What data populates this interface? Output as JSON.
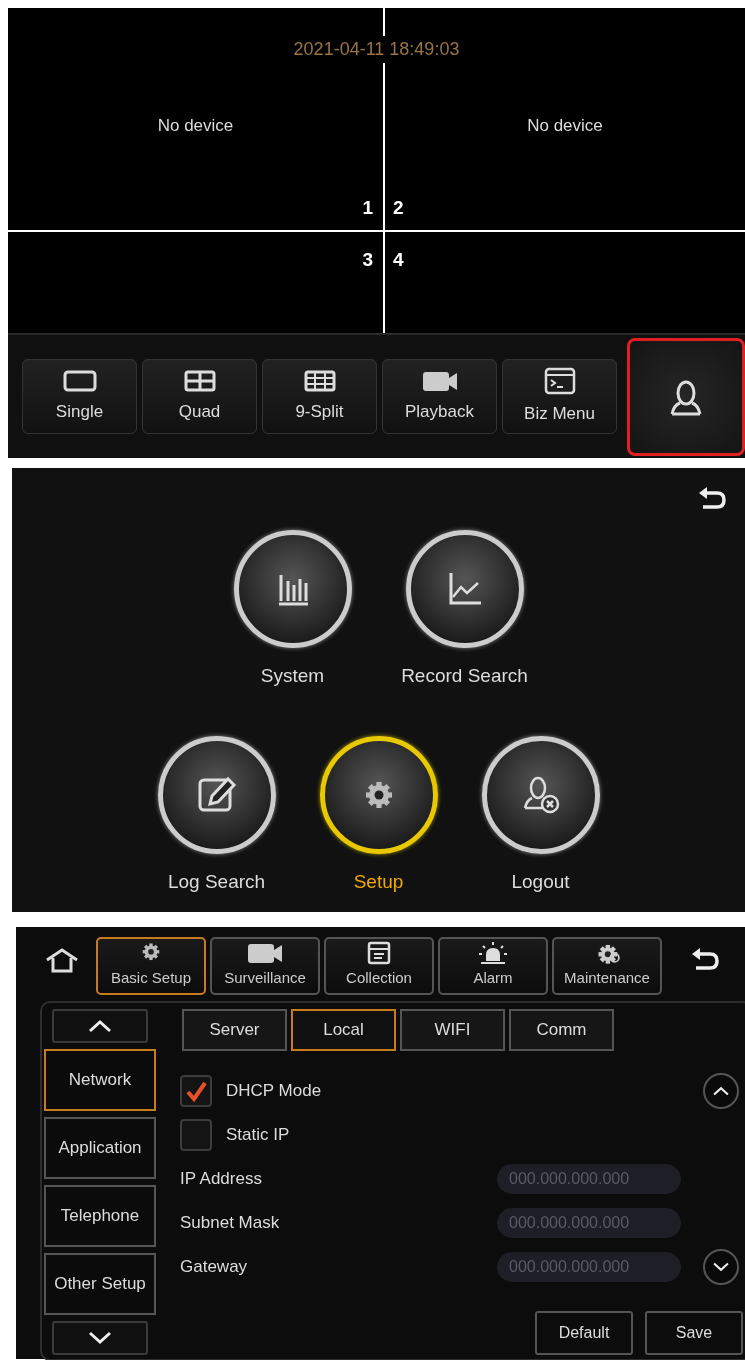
{
  "live_view": {
    "timestamp": "2021-04-11 18:49:03",
    "cells": [
      {
        "number": "1",
        "message": "No device"
      },
      {
        "number": "2",
        "message": "No device"
      },
      {
        "number": "3"
      },
      {
        "number": "4"
      }
    ],
    "toolbar": [
      {
        "label": "Single",
        "kind": "single"
      },
      {
        "label": "Quad",
        "kind": "quad"
      },
      {
        "label": "9-Split",
        "kind": "nine"
      },
      {
        "label": "Playback",
        "kind": "camera"
      },
      {
        "label": "Biz Menu",
        "kind": "terminal"
      }
    ],
    "user_button": {
      "highlighted": true
    }
  },
  "main_menu": {
    "rows": [
      [
        {
          "label": "System",
          "kind": "bars",
          "selected": false
        },
        {
          "label": "Record Search",
          "kind": "line",
          "selected": false
        }
      ],
      [
        {
          "label": "Log Search",
          "kind": "edit",
          "selected": false
        },
        {
          "label": "Setup",
          "kind": "gear",
          "selected": true
        },
        {
          "label": "Logout",
          "kind": "logout",
          "selected": false
        }
      ]
    ]
  },
  "setup": {
    "top_tabs": [
      {
        "label": "Basic Setup",
        "kind": "gear",
        "selected": true
      },
      {
        "label": "Surveillance",
        "kind": "camera",
        "selected": false
      },
      {
        "label": "Collection",
        "kind": "window",
        "selected": false
      },
      {
        "label": "Alarm",
        "kind": "alarm",
        "selected": false
      },
      {
        "label": "Maintenance",
        "kind": "gears",
        "selected": false
      }
    ],
    "side_items": [
      {
        "label": "Network",
        "selected": true
      },
      {
        "label": "Application",
        "selected": false
      },
      {
        "label": "Telephone",
        "selected": false
      },
      {
        "label": "Other Setup",
        "selected": false
      }
    ],
    "sub_tabs": [
      {
        "label": "Server",
        "selected": false
      },
      {
        "label": "Local",
        "selected": true
      },
      {
        "label": "WIFI",
        "selected": false
      },
      {
        "label": "Comm",
        "selected": false
      }
    ],
    "options": [
      {
        "label": "DHCP Mode",
        "checked": true
      },
      {
        "label": "Static IP",
        "checked": false
      }
    ],
    "fields": [
      {
        "label": "IP Address",
        "placeholder": "000.000.000.000"
      },
      {
        "label": "Subnet Mask",
        "placeholder": "000.000.000.000"
      },
      {
        "label": "Gateway",
        "placeholder": "000.000.000.000"
      }
    ],
    "buttons": [
      "Default",
      "Save"
    ]
  }
}
